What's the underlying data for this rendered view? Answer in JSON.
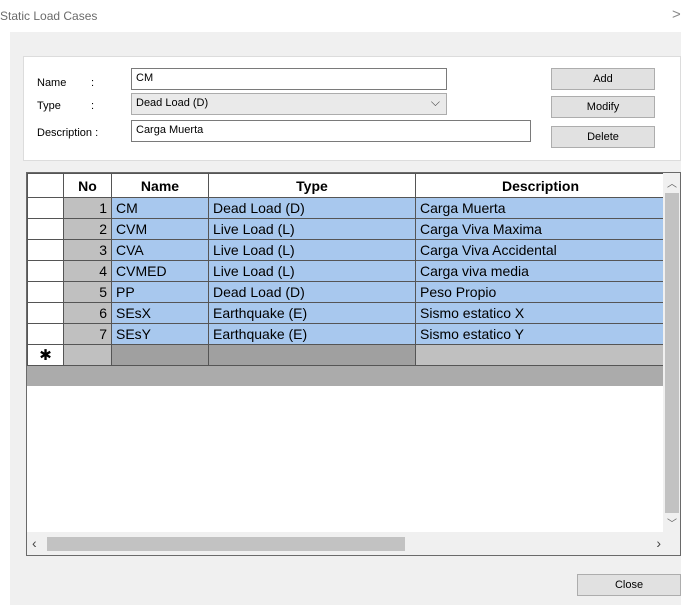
{
  "window": {
    "title": "Static Load Cases",
    "close_glyph": ">"
  },
  "form": {
    "name_label": "Name",
    "type_label": "Type",
    "description_label": "Description :",
    "colon": ":",
    "name_value": "CM",
    "type_value": "Dead Load (D)",
    "description_value": "Carga Muerta"
  },
  "buttons": {
    "add": "Add",
    "modify": "Modify",
    "delete": "Delete",
    "close": "Close"
  },
  "grid": {
    "columns": [
      "",
      "No",
      "Name",
      "Type",
      "Description"
    ],
    "rows": [
      {
        "no": "1",
        "name": "CM",
        "type": "Dead Load (D)",
        "description": "Carga Muerta"
      },
      {
        "no": "2",
        "name": "CVM",
        "type": "Live Load (L)",
        "description": "Carga Viva Maxima"
      },
      {
        "no": "3",
        "name": "CVA",
        "type": "Live Load (L)",
        "description": "Carga Viva Accidental"
      },
      {
        "no": "4",
        "name": "CVMED",
        "type": "Live Load (L)",
        "description": "Carga viva media"
      },
      {
        "no": "5",
        "name": "PP",
        "type": "Dead Load (D)",
        "description": "Peso Propio"
      },
      {
        "no": "6",
        "name": "SEsX",
        "type": "Earthquake (E)",
        "description": "Sismo estatico X"
      },
      {
        "no": "7",
        "name": "SEsY",
        "type": "Earthquake (E)",
        "description": "Sismo estatico Y"
      }
    ],
    "new_row_marker": "✱"
  },
  "icons": {
    "combo_arrow": "chevron-down-icon",
    "scroll_up": "scroll-up-icon",
    "scroll_down": "scroll-down-icon",
    "scroll_left": "scroll-left-icon",
    "scroll_right": "scroll-right-icon"
  }
}
